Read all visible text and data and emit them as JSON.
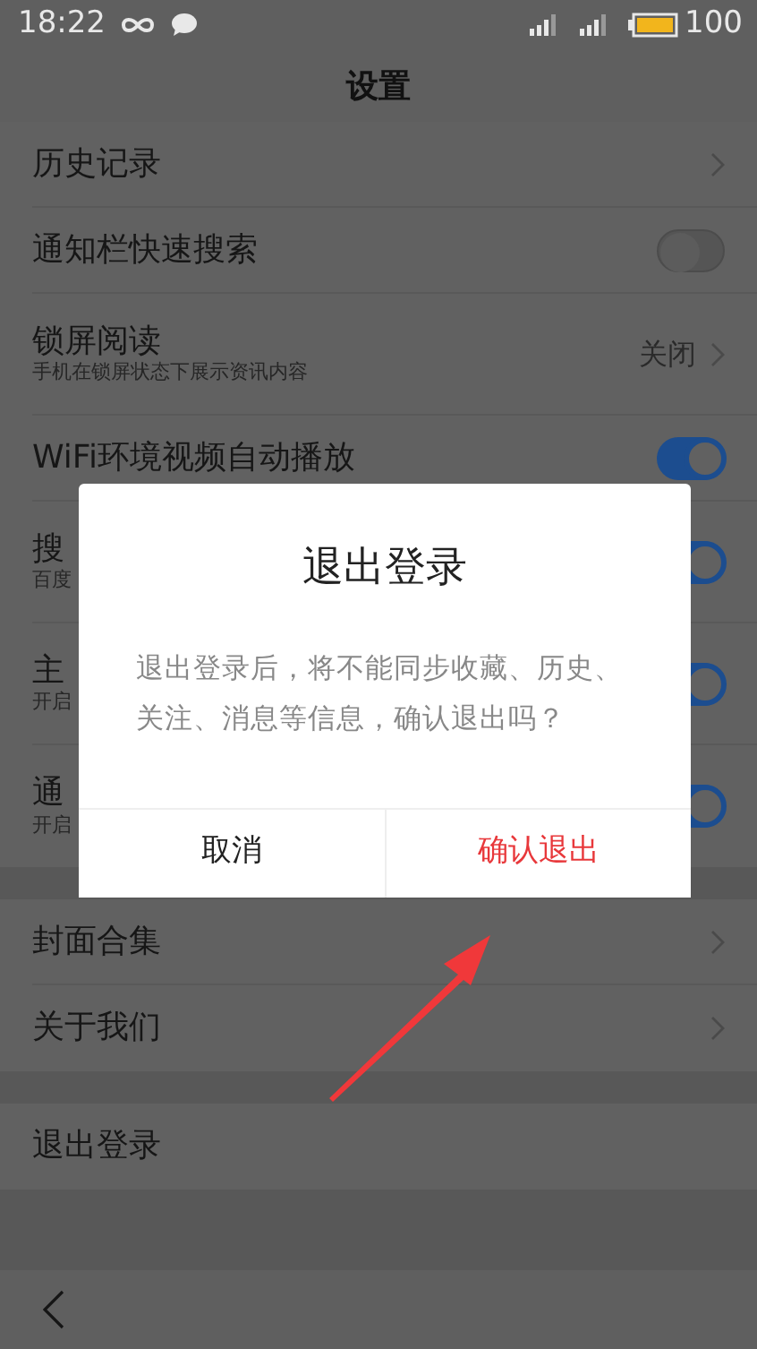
{
  "status_bar": {
    "time": "18:22",
    "battery": "100"
  },
  "title": "设置",
  "sections": [
    {
      "items": [
        {
          "kind": "chevron",
          "label": "历史记录"
        },
        {
          "kind": "toggle",
          "label": "通知栏快速搜索",
          "on": false
        },
        {
          "kind": "chevron",
          "label": "锁屏阅读",
          "subtitle": "手机在锁屏状态下展示资讯内容",
          "value": "关闭"
        },
        {
          "kind": "toggle",
          "label": "WiFi环境视频自动播放",
          "on": true
        },
        {
          "kind": "toggle",
          "label": "搜",
          "subtitle": "百度",
          "on": true
        },
        {
          "kind": "toggle",
          "label": "主",
          "subtitle": "开启",
          "on": true
        },
        {
          "kind": "toggle",
          "label": "通",
          "subtitle": "开启",
          "on": true
        }
      ]
    },
    {
      "items": [
        {
          "kind": "chevron",
          "label": "封面合集"
        },
        {
          "kind": "chevron",
          "label": "关于我们"
        }
      ]
    },
    {
      "items": [
        {
          "kind": "plain",
          "label": "退出登录"
        }
      ]
    }
  ],
  "dialog": {
    "title": "退出登录",
    "message": "退出登录后，将不能同步收藏、历史、关注、消息等信息，确认退出吗？",
    "buttons": [
      {
        "label": "取消",
        "kind": "cancel"
      },
      {
        "label": "确认退出",
        "kind": "confirm"
      }
    ]
  }
}
